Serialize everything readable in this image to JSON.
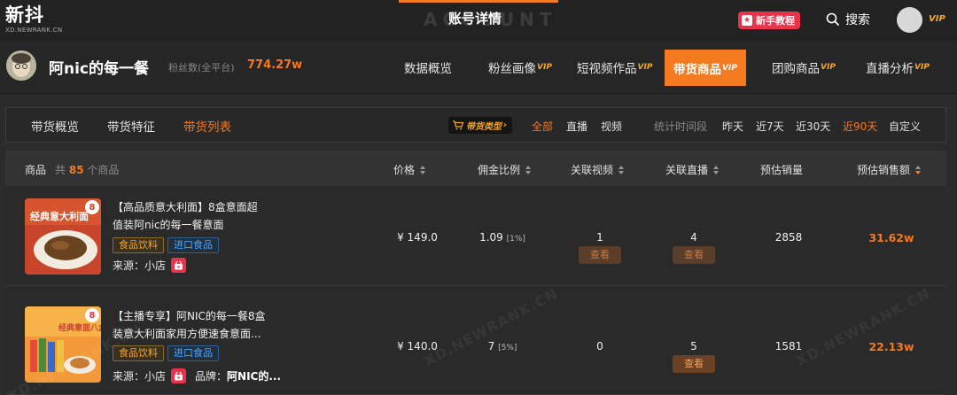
{
  "topbar": {
    "logo": "新抖",
    "logo_sub": "XD.NEWRANK.CN",
    "ghost_title": "ACCOUNT",
    "title": "账号详情",
    "tutorial": "新手教程",
    "search": "搜索",
    "vip": "VIP"
  },
  "account": {
    "name": "阿nic的每一餐",
    "fans_label": "粉丝数(全平台)",
    "fans_value": "774.27w"
  },
  "nav": {
    "items": [
      {
        "label": "数据概览",
        "vip": ""
      },
      {
        "label": "粉丝画像",
        "vip": "VIP"
      },
      {
        "label": "短视频作品",
        "vip": "VIP"
      },
      {
        "label": "带货商品",
        "vip": "VIP"
      },
      {
        "label": "团购商品",
        "vip": "VIP"
      },
      {
        "label": "直播分析",
        "vip": "VIP"
      }
    ]
  },
  "subtabs": {
    "items": [
      "带货概览",
      "带货特征",
      "带货列表"
    ],
    "type_badge": "带货类型",
    "types": [
      "全部",
      "直播",
      "视频"
    ],
    "period_label": "统计时间段",
    "periods": [
      "昨天",
      "近7天",
      "近30天",
      "近90天",
      "自定义"
    ]
  },
  "table": {
    "headers": {
      "product": "商品",
      "count_prefix": "共",
      "count": "85",
      "count_suffix": "个商品",
      "price": "价格",
      "commission": "佣金比例",
      "videos": "关联视频",
      "lives": "关联直播",
      "sales": "预估销量",
      "amount": "预估销售额"
    },
    "view_label": "查看",
    "source_label": "来源：",
    "brand_label": "品牌：",
    "rows": [
      {
        "title_line1": "【高品质意大利面】8盒意面超",
        "title_line2": "值装阿nic的每一餐意面",
        "tag1": "食品饮料",
        "tag2": "进口食品",
        "source": "小店",
        "brand": "",
        "price": "¥ 149.0",
        "commission": "1.09",
        "commission_pct": "[1%]",
        "videos": "1",
        "lives": "4",
        "sales": "2858",
        "amount": "31.62w",
        "thumb_text": "经典意大利面"
      },
      {
        "title_line1": "【主播专享】阿NIC的每一餐8盒",
        "title_line2": "装意大利面家用方便速食意面...",
        "tag1": "食品饮料",
        "tag2": "进口食品",
        "source": "小店",
        "brand": "阿NIC的...",
        "price": "¥ 140.0",
        "commission": "7",
        "commission_pct": "[5%]",
        "videos": "0",
        "lives": "5",
        "sales": "1581",
        "amount": "22.13w",
        "thumb_text": "经典意面八盒装"
      }
    ]
  },
  "watermark": "XD.NEWRANK.CN",
  "colors": {
    "accent": "#f47a20",
    "vip": "#f5a623",
    "tutorial": "#e8334a",
    "import_tag": "#4aa3ff"
  }
}
